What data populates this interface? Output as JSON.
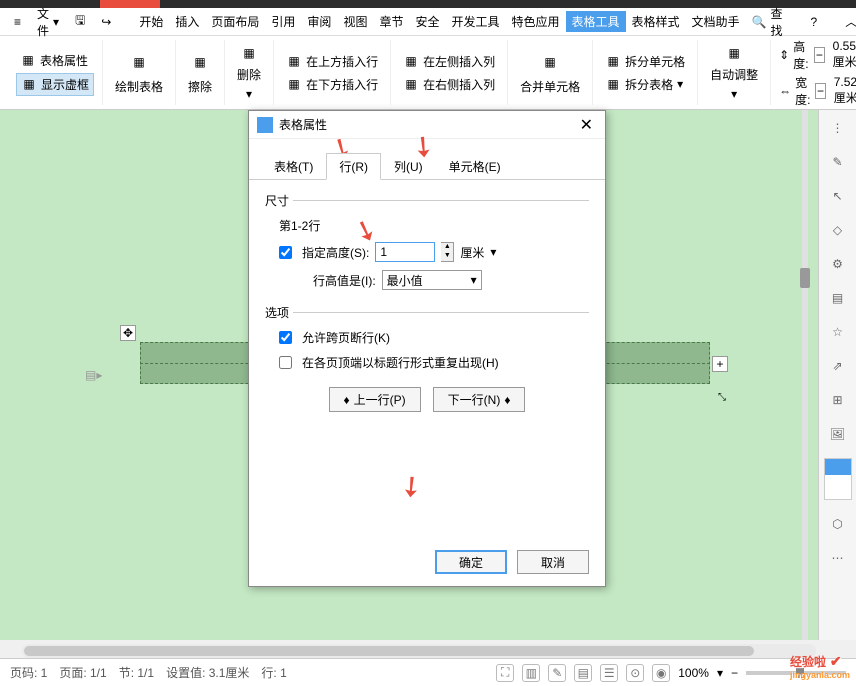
{
  "menubar": {
    "file": "文件",
    "items": [
      "开始",
      "插入",
      "页面布局",
      "引用",
      "审阅",
      "视图",
      "章节",
      "安全",
      "开发工具",
      "特色应用",
      "表格工具",
      "表格样式",
      "文档助手"
    ],
    "active_index": 10,
    "find": "查找",
    "help": "?"
  },
  "ribbon": {
    "table_props": "表格属性",
    "show_frame": "显示虚框",
    "draw_table": "绘制表格",
    "erase": "擦除",
    "delete": "删除",
    "insert_above": "在上方插入行",
    "insert_below": "在下方插入行",
    "insert_left": "在左侧插入列",
    "insert_right": "在右侧插入列",
    "merge_cells": "合并单元格",
    "split_cells": "拆分单元格",
    "split_table": "拆分表格",
    "auto_adjust": "自动调整",
    "height_label": "高度:",
    "width_label": "宽度:",
    "height_val": "0.55厘米",
    "width_val": "7.52厘米"
  },
  "dialog": {
    "title": "表格属性",
    "tabs": {
      "table": "表格(T)",
      "row": "行(R)",
      "column": "列(U)",
      "cell": "单元格(E)"
    },
    "size_label": "尺寸",
    "row_range": "第1-2行",
    "spec_height": "指定高度(S):",
    "height_value": "1",
    "unit": "厘米",
    "row_height_is": "行高值是(I):",
    "row_height_mode": "最小值",
    "options_label": "选项",
    "allow_break": "允许跨页断行(K)",
    "repeat_header": "在各页顶端以标题行形式重复出现(H)",
    "prev_row": "上一行(P)",
    "next_row": "下一行(N)",
    "ok": "确定",
    "cancel": "取消"
  },
  "status": {
    "page_no": "页码: 1",
    "page": "页面: 1/1",
    "section": "节: 1/1",
    "setting": "设置值: 3.1厘米",
    "row": "行: 1",
    "zoom": "100%"
  },
  "watermark": {
    "main": "经验啦",
    "sub": "jingyanla.com"
  }
}
